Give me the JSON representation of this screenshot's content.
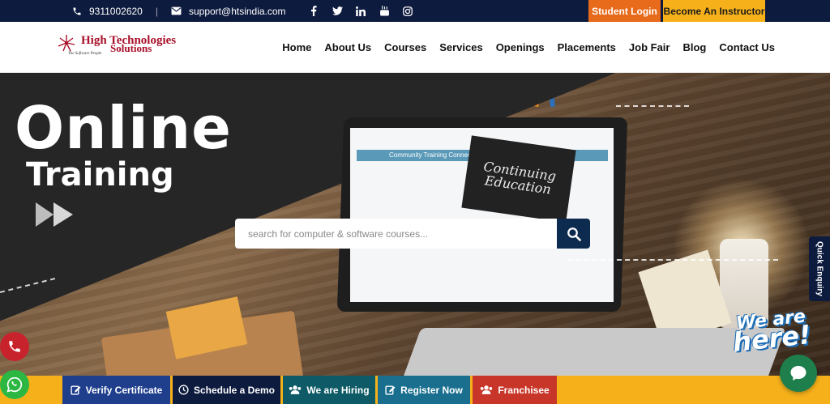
{
  "topbar": {
    "phone": "9311002620",
    "separator": "|",
    "email": "support@htsindia.com",
    "social_icons": [
      "facebook-icon",
      "twitter-icon",
      "linkedin-icon",
      "youtube-icon",
      "instagram-icon"
    ],
    "student_login": "Student Login",
    "become_instructor": "Become An Instructor"
  },
  "header": {
    "logo_line1": "High Technologies",
    "logo_line2": "Solutions",
    "logo_tagline": "The Software People",
    "nav": [
      "Home",
      "About Us",
      "Courses",
      "Services",
      "Openings",
      "Placements",
      "Job Fair",
      "Blog",
      "Contact Us"
    ]
  },
  "hero": {
    "heading_line1": "Online",
    "heading_line2": "Training",
    "screen_title": "Community Training Connection",
    "screen_image_text": "Continuing Education",
    "search_placeholder": "search for computer & software courses..."
  },
  "sidebar": {
    "quick_enquiry": "Quick Enquiry"
  },
  "widget": {
    "we_are": "We are",
    "here": "here!"
  },
  "bottombar": {
    "verify": "Verify Certificate",
    "demo": "Schedule a Demo",
    "hiring": "We are Hiring",
    "register": "Register Now",
    "franchisee": "Franchisee"
  },
  "colors": {
    "navy": "#0d1b3e",
    "orange": "#e86a1b",
    "yellow": "#f6b11a",
    "brand_red": "#a8102a"
  }
}
